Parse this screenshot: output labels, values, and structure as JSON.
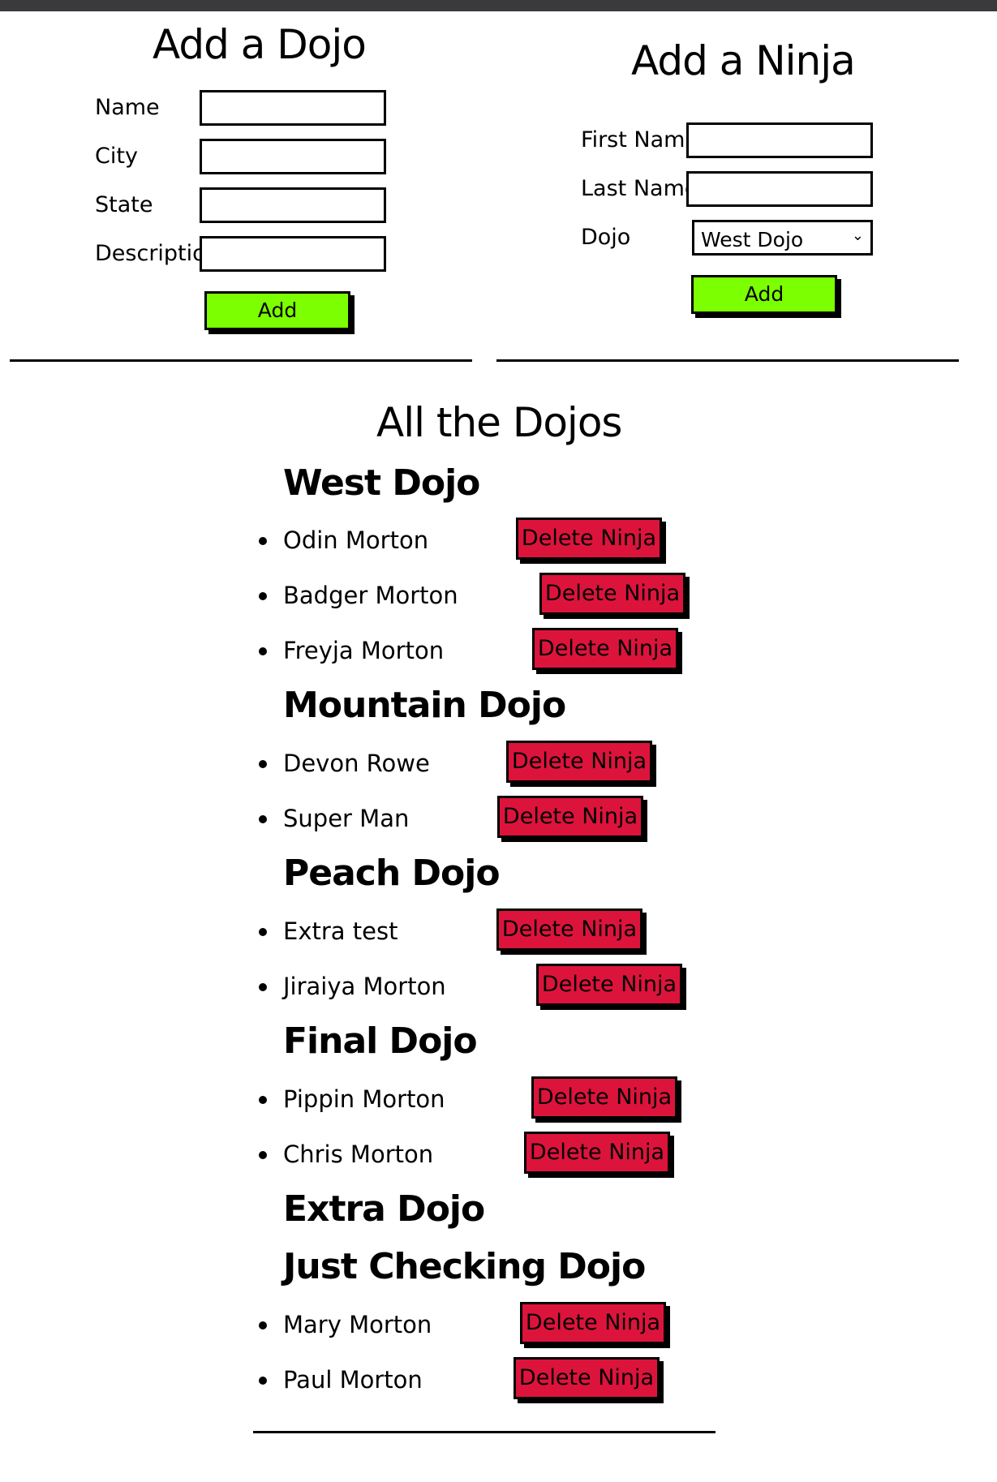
{
  "add_dojo": {
    "title": "Add a Dojo",
    "labels": {
      "name": "Name",
      "city": "City",
      "state": "State",
      "description": "Description"
    },
    "fields": {
      "name": "",
      "city": "",
      "state": "",
      "description": ""
    },
    "add_label": "Add"
  },
  "add_ninja": {
    "title": "Add a Ninja",
    "labels": {
      "first_name": "First Name",
      "last_name": "Last Name",
      "dojo": "Dojo"
    },
    "fields": {
      "first_name": "",
      "last_name": ""
    },
    "dojo_selected": "West Dojo",
    "add_label": "Add"
  },
  "all_dojos": {
    "title": "All the Dojos",
    "delete_label": "Delete Ninja",
    "dojos": [
      {
        "name": "West Dojo",
        "ninjas": [
          "Odin Morton",
          "Badger Morton",
          "Freyja Morton"
        ]
      },
      {
        "name": "Mountain Dojo",
        "ninjas": [
          "Devon Rowe",
          "Super Man"
        ]
      },
      {
        "name": "Peach Dojo",
        "ninjas": [
          "Extra test",
          "Jiraiya Morton"
        ]
      },
      {
        "name": "Final Dojo",
        "ninjas": [
          "Pippin Morton",
          "Chris Morton"
        ]
      },
      {
        "name": "Extra Dojo",
        "ninjas": []
      },
      {
        "name": "Just Checking Dojo",
        "ninjas": [
          "Mary Morton",
          "Paul Morton"
        ]
      }
    ]
  },
  "colors": {
    "add_button": "#7cff00",
    "delete_button": "#dc143c",
    "top_bar": "#3a3a3c"
  }
}
